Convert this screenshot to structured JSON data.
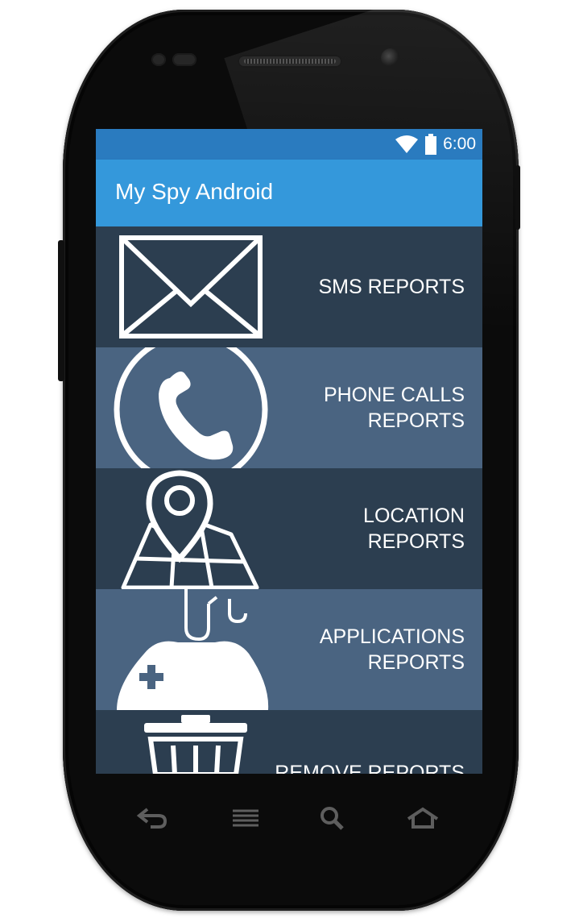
{
  "status_bar": {
    "time": "6:00",
    "icons": [
      "wifi-icon",
      "battery-icon"
    ]
  },
  "app_bar": {
    "title": "My Spy Android"
  },
  "menu": [
    {
      "label": "SMS REPORTS",
      "icon": "envelope-icon"
    },
    {
      "label": "PHONE CALLS\nREPORTS",
      "icon": "phone-icon"
    },
    {
      "label": "LOCATION\nREPORTS",
      "icon": "map-pin-icon"
    },
    {
      "label": "APPLICATIONS\nREPORTS",
      "icon": "gamepad-icon"
    },
    {
      "label": "REMOVE REPORTS",
      "icon": "trash-icon"
    }
  ],
  "nav_bar": {
    "buttons": [
      "back-icon",
      "menu-icon",
      "search-icon",
      "home-icon"
    ]
  },
  "colors": {
    "status_bar": "#2a7bbf",
    "app_bar": "#3498db",
    "row_dark": "#2c3e50",
    "row_light": "#4a6481",
    "device_body": "#0b0b0b"
  }
}
